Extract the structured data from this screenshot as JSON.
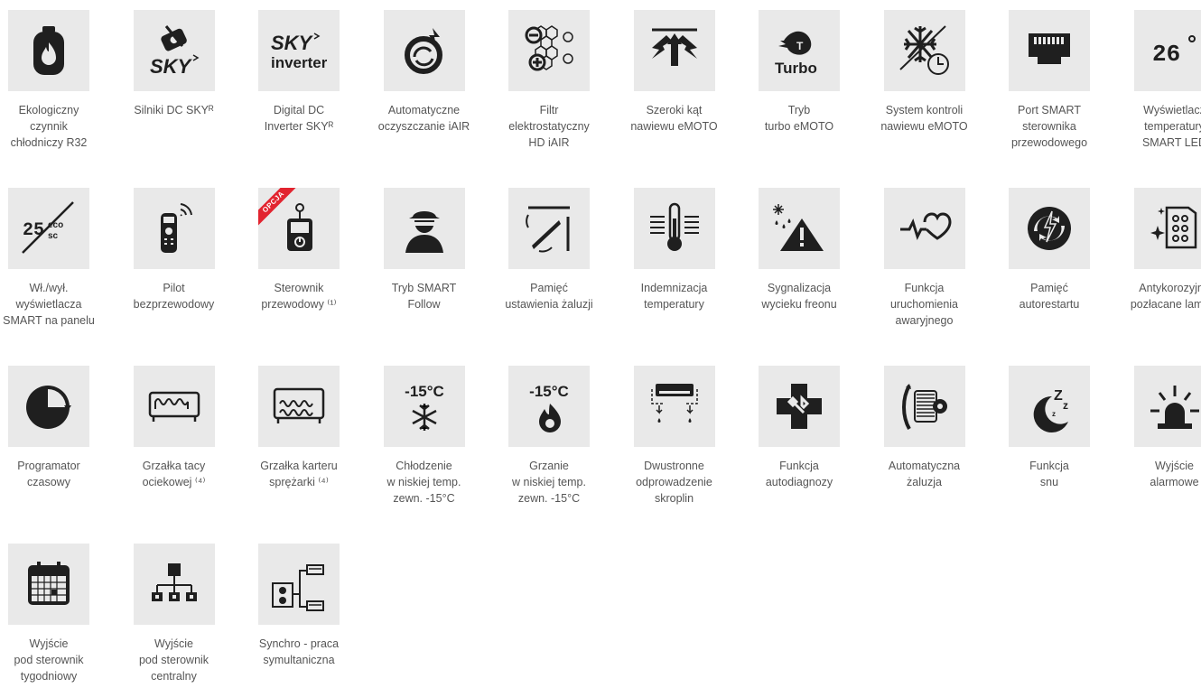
{
  "features": [
    {
      "icon": "gas-cylinder-icon",
      "lines": [
        "Ekologiczny",
        "czynnik",
        "chłodniczy R32"
      ]
    },
    {
      "icon": "sky-dc-motor-icon",
      "lines": [
        "Silniki DC SKYᴿ"
      ]
    },
    {
      "icon": "sky-inverter-icon",
      "lines": [
        "Digital DC",
        "Inverter SKYᴿ"
      ]
    },
    {
      "icon": "auto-clean-icon",
      "lines": [
        "Automatyczne",
        "oczyszczanie iAIR"
      ]
    },
    {
      "icon": "electrostatic-filter-icon",
      "lines": [
        "Filtr",
        "elektrostatyczny",
        "HD iAIR"
      ]
    },
    {
      "icon": "wide-airflow-icon",
      "lines": [
        "Szeroki kąt",
        "nawiewu eMOTO"
      ]
    },
    {
      "icon": "turbo-mode-icon",
      "lines": [
        "Tryb",
        "turbo eMOTO"
      ]
    },
    {
      "icon": "airflow-control-icon",
      "lines": [
        "System kontroli",
        "nawiewu eMOTO"
      ]
    },
    {
      "icon": "smart-port-icon",
      "lines": [
        "Port SMART",
        "sterownika",
        "przewodowego"
      ]
    },
    {
      "icon": "led-display-icon",
      "lines": [
        "Wyświetlacz",
        "temperatury",
        "SMART LED"
      ]
    },
    {
      "icon": "display-toggle-icon",
      "lines": [
        "Wł./wył.",
        "wyświetlacza",
        "SMART na panelu"
      ]
    },
    {
      "icon": "wireless-remote-icon",
      "lines": [
        "Pilot",
        "bezprzewodowy"
      ]
    },
    {
      "icon": "wired-controller-icon",
      "lines": [
        "Sterownik",
        "przewodowy ⁽¹⁾"
      ],
      "ribbon": "OPCJA"
    },
    {
      "icon": "spy-icon",
      "lines": [
        "Tryb SMART",
        "Follow"
      ]
    },
    {
      "icon": "louver-memory-icon",
      "lines": [
        "Pamięć",
        "ustawienia żaluzji"
      ]
    },
    {
      "icon": "thermometer-icon",
      "lines": [
        "Indemnizacja",
        "temperatury"
      ]
    },
    {
      "icon": "leak-warning-icon",
      "lines": [
        "Sygnalizacja",
        "wycieku freonu"
      ]
    },
    {
      "icon": "heartbeat-icon",
      "lines": [
        "Funkcja",
        "uruchomienia",
        "awaryjnego"
      ]
    },
    {
      "icon": "autorestart-icon",
      "lines": [
        "Pamięć",
        "autorestartu"
      ]
    },
    {
      "icon": "gold-fins-icon",
      "lines": [
        "Antykorozyjne",
        "pozłacane lamele"
      ]
    },
    {
      "icon": "timer-icon",
      "lines": [
        "Programator",
        "czasowy"
      ]
    },
    {
      "icon": "tray-heater-icon",
      "lines": [
        "Grzałka tacy",
        "ociekowej ⁽⁴⁾"
      ]
    },
    {
      "icon": "crankcase-heater-icon",
      "lines": [
        "Grzałka karteru",
        "sprężarki ⁽⁴⁾"
      ]
    },
    {
      "icon": "low-temp-cooling-icon",
      "lines": [
        "Chłodzenie",
        "w niskiej temp.",
        "zewn. -15°C"
      ],
      "icon_text": "-15°C"
    },
    {
      "icon": "low-temp-heating-icon",
      "lines": [
        "Grzanie",
        "w niskiej temp.",
        "zewn. -15°C"
      ],
      "icon_text": "-15°C"
    },
    {
      "icon": "dual-drain-icon",
      "lines": [
        "Dwustronne",
        "odprowadzenie",
        "skroplin"
      ]
    },
    {
      "icon": "self-diagnosis-icon",
      "lines": [
        "Funkcja",
        "autodiagnozy"
      ]
    },
    {
      "icon": "auto-louver-icon",
      "lines": [
        "Automatyczna",
        "żaluzja"
      ]
    },
    {
      "icon": "sleep-icon",
      "lines": [
        "Funkcja",
        "snu"
      ]
    },
    {
      "icon": "alarm-light-icon",
      "lines": [
        "Wyjście",
        "alarmowe"
      ]
    },
    {
      "icon": "weekly-calendar-icon",
      "lines": [
        "Wyjście",
        "pod sterownik",
        "tygodniowy"
      ]
    },
    {
      "icon": "central-controller-icon",
      "lines": [
        "Wyjście",
        "pod sterownik",
        "centralny"
      ]
    },
    {
      "icon": "synchro-icon",
      "lines": [
        "Synchro - praca",
        "symultaniczna"
      ]
    }
  ],
  "colors": {
    "tile_bg": "#e9e9e9",
    "icon": "#1f1f1f",
    "label": "#555555",
    "ribbon": "#e2242f"
  }
}
